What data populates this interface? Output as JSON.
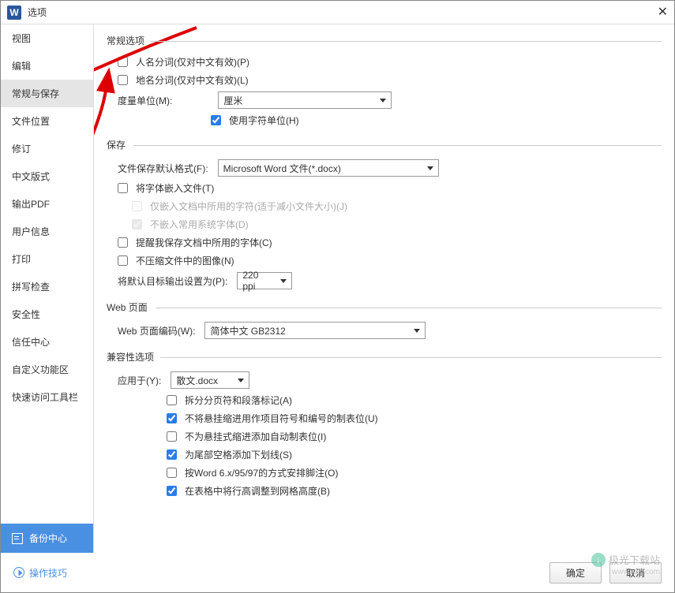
{
  "window": {
    "title": "选项",
    "logo_letter": "W"
  },
  "sidebar": {
    "items": [
      {
        "label": "视图"
      },
      {
        "label": "编辑"
      },
      {
        "label": "常规与保存",
        "selected": true
      },
      {
        "label": "文件位置"
      },
      {
        "label": "修订"
      },
      {
        "label": "中文版式"
      },
      {
        "label": "输出PDF"
      },
      {
        "label": "用户信息"
      },
      {
        "label": "打印"
      },
      {
        "label": "拼写检查"
      },
      {
        "label": "安全性"
      },
      {
        "label": "信任中心"
      },
      {
        "label": "自定义功能区"
      },
      {
        "label": "快速访问工具栏"
      }
    ],
    "backup_label": "备份中心"
  },
  "general": {
    "section": "常规选项",
    "personal_name": "人名分词(仅对中文有效)(P)",
    "place_name": "地名分词(仅对中文有效)(L)",
    "unit_label": "度量单位(M):",
    "unit_value": "厘米",
    "use_char_unit": "使用字符单位(H)"
  },
  "save": {
    "section": "保存",
    "default_format_label": "文件保存默认格式(F):",
    "default_format_value": "Microsoft Word 文件(*.docx)",
    "embed_fonts": "将字体嵌入文件(T)",
    "embed_only_used": "仅嵌入文档中所用的字符(适于减小文件大小)(J)",
    "no_embed_system": "不嵌入常用系统字体(D)",
    "remind_fonts": "提醒我保存文档中所用的字体(C)",
    "no_compress_img": "不压缩文件中的图像(N)",
    "default_output_label": "将默认目标输出设置为(P):",
    "default_output_value": "220 ppi"
  },
  "web": {
    "section": "Web 页面",
    "encoding_label": "Web 页面编码(W):",
    "encoding_value": "简体中文 GB2312"
  },
  "compat": {
    "section": "兼容性选项",
    "apply_label": "应用于(Y):",
    "apply_value": "散文.docx",
    "split_page": "拆分分页符和段落标记(A)",
    "no_hanging_tab": "不将悬挂缩进用作项目符号和编号的制表位(U)",
    "no_auto_tab": "不为悬挂式缩进添加自动制表位(I)",
    "trailing_underline": "为尾部空格添加下划线(S)",
    "word6_footnote": "按Word 6.x/95/97的方式安排脚注(O)",
    "grid_row_height": "在表格中将行高调整到网格高度(B)"
  },
  "footer": {
    "tips": "操作技巧",
    "ok": "确定",
    "cancel": "取消"
  },
  "watermark": {
    "text": "极光下载站",
    "url": "www.xz7.com"
  }
}
